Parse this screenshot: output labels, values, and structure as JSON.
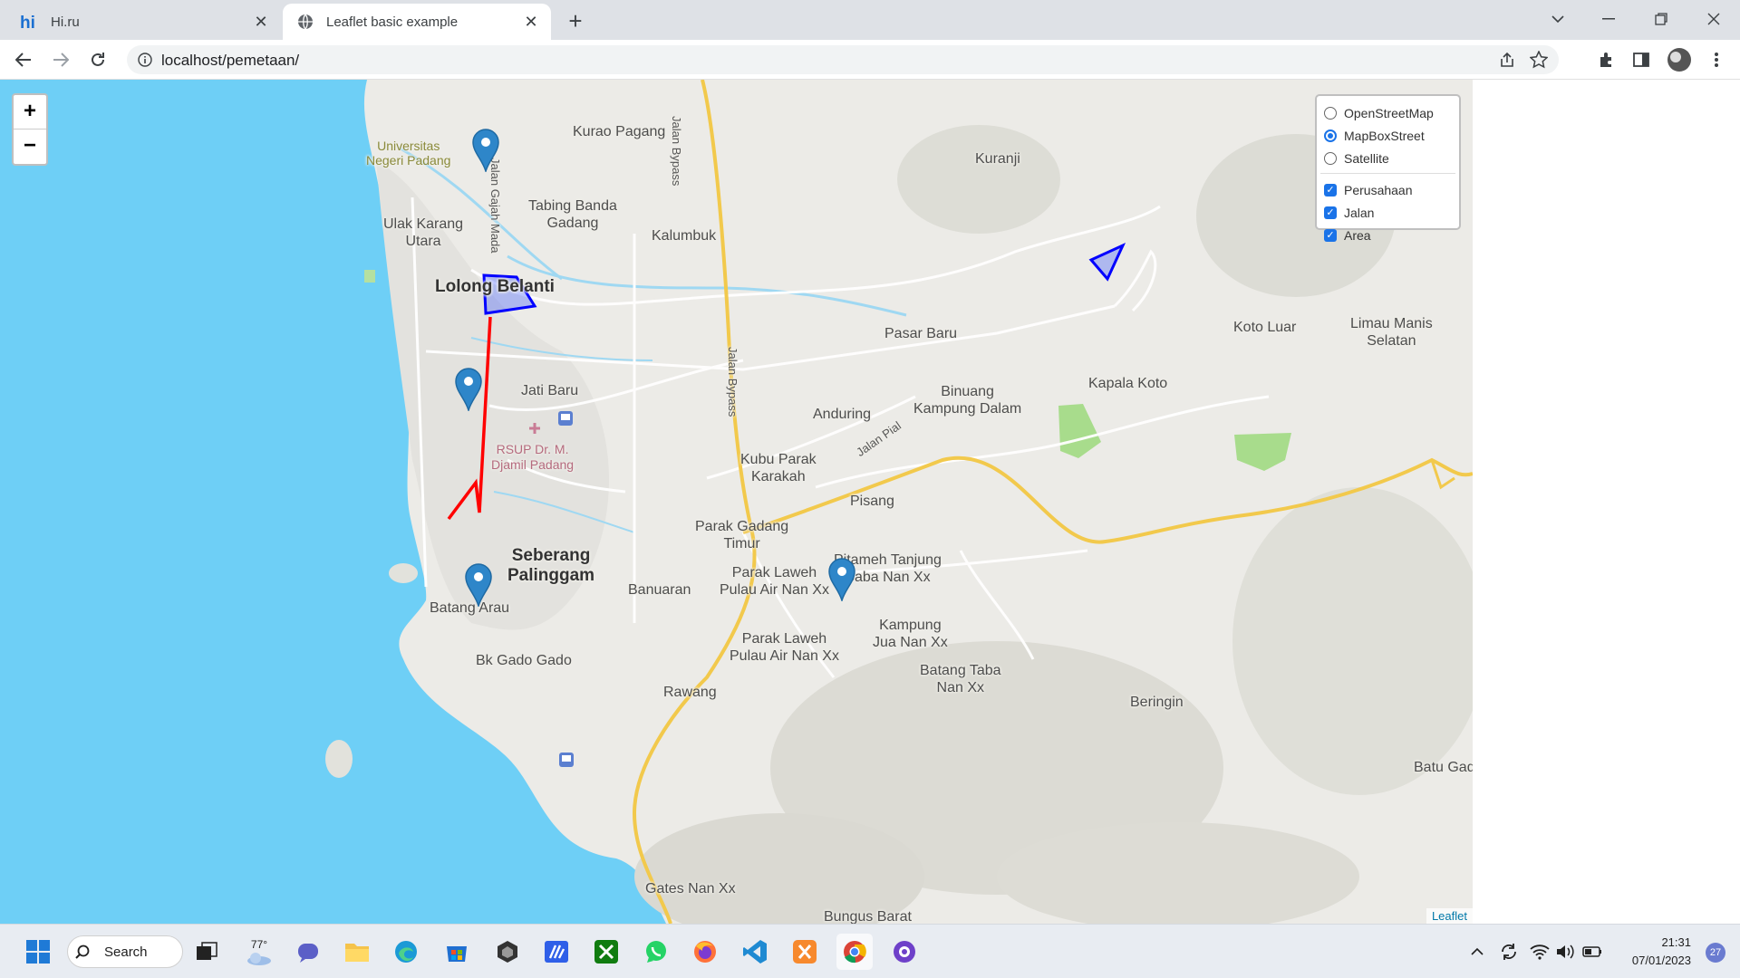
{
  "browser": {
    "tabs": [
      {
        "title": "Hi.ru",
        "icon": "hi-ru-icon",
        "active": false
      },
      {
        "title": "Leaflet basic example",
        "icon": "globe-icon",
        "active": true
      }
    ],
    "url": "localhost/pemetaan/"
  },
  "map": {
    "zoom_in": "+",
    "zoom_out": "−",
    "layer_control": {
      "base_layers": [
        {
          "label": "OpenStreetMap",
          "selected": false
        },
        {
          "label": "MapBoxStreet",
          "selected": true
        },
        {
          "label": "Satellite",
          "selected": false
        }
      ],
      "overlays": [
        {
          "label": "Perusahaan",
          "checked": true
        },
        {
          "label": "Jalan",
          "checked": true
        },
        {
          "label": "Area",
          "checked": true
        }
      ]
    },
    "attribution": "Leaflet",
    "place_labels": [
      {
        "text": "Universitas\nNegeri Padang",
        "style": "green"
      },
      {
        "text": "Kurao Pagang",
        "style": "normal"
      },
      {
        "text": "Jalan Bypass",
        "style": "road"
      },
      {
        "text": "Kuranji",
        "style": "normal"
      },
      {
        "text": "Jalan Gajah Mada",
        "style": "road"
      },
      {
        "text": "Tabing Banda\nGadang",
        "style": "normal"
      },
      {
        "text": "Ulak Karang\nUtara",
        "style": "normal"
      },
      {
        "text": "Kalumbuk",
        "style": "normal"
      },
      {
        "text": "Lolong Belanti",
        "style": "big"
      },
      {
        "text": "Pasar Baru",
        "style": "normal"
      },
      {
        "text": "Koto Luar",
        "style": "normal"
      },
      {
        "text": "Limau Manis\nSelatan",
        "style": "normal"
      },
      {
        "text": "Jalan Bypass",
        "style": "road"
      },
      {
        "text": "Jati Baru",
        "style": "normal"
      },
      {
        "text": "Binuang\nKampung Dalam",
        "style": "normal"
      },
      {
        "text": "Kapala Koto",
        "style": "normal"
      },
      {
        "text": "Anduring",
        "style": "normal"
      },
      {
        "text": "RSUP Dr. M.\nDjamil Padang",
        "style": "pink"
      },
      {
        "text": "Jalan Pial",
        "style": "road"
      },
      {
        "text": "Kubu Parak\nKarakah",
        "style": "normal"
      },
      {
        "text": "Pisang",
        "style": "normal"
      },
      {
        "text": "Parak Gadang\nTimur",
        "style": "normal"
      },
      {
        "text": "Seberang\nPalinggam",
        "style": "big"
      },
      {
        "text": "Pitameh Tanjung\nSaba Nan Xx",
        "style": "normal"
      },
      {
        "text": "Parak Laweh\nPulau Air Nan Xx",
        "style": "normal"
      },
      {
        "text": "Banuaran",
        "style": "normal"
      },
      {
        "text": "Batang Arau",
        "style": "normal"
      },
      {
        "text": "Kampung\nJua Nan Xx",
        "style": "normal"
      },
      {
        "text": "Parak Laweh\nPulau Air Nan Xx",
        "style": "normal"
      },
      {
        "text": "Bk Gado Gado",
        "style": "normal"
      },
      {
        "text": "Batang Taba\nNan Xx",
        "style": "normal"
      },
      {
        "text": "Rawang",
        "style": "normal"
      },
      {
        "text": "Beringin",
        "style": "normal"
      },
      {
        "text": "Batu Gad",
        "style": "normal"
      },
      {
        "text": "Gates Nan Xx",
        "style": "normal"
      },
      {
        "text": "Bungus Barat",
        "style": "normal"
      }
    ]
  },
  "taskbar": {
    "search_label": "Search",
    "weather": "77°",
    "time": "21:31",
    "date": "07/01/2023",
    "notifications": "27"
  },
  "colors": {
    "sea": "#6ecff6",
    "land": "#ecebe7",
    "road_major": "#f2c94c",
    "line": "#ff0000",
    "polygon": "#0000ff",
    "marker": "#2e86c9",
    "accent": "#1a73e8"
  }
}
